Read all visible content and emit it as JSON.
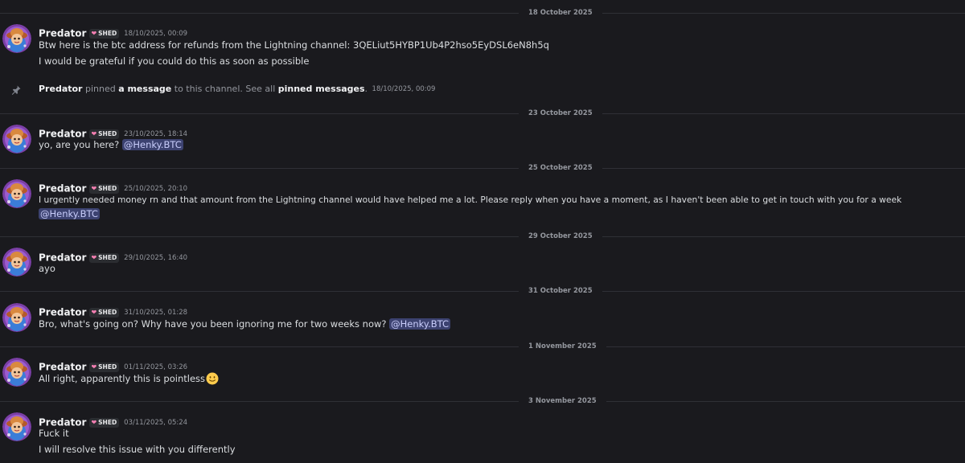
{
  "channel": {
    "author": "Predator",
    "tag": "SHED",
    "mention": "@Henky.BTC"
  },
  "dividers": [
    "18 October 2025",
    "23 October 2025",
    "25 October 2025",
    "29 October 2025",
    "31 October 2025",
    "1 November 2025",
    "3 November 2025"
  ],
  "messages": [
    {
      "timestamp": "18/10/2025, 00:09",
      "lines": [
        "Btw here is the btc address for refunds from the Lightning channel: 3QELiut5HYBP1Ub4P2hso5EyDSL6eN8h5q",
        "I would be grateful if you could do this as soon as possible"
      ]
    },
    {
      "timestamp": "23/10/2025, 18:14",
      "lines": [
        "yo, are you here?"
      ]
    },
    {
      "timestamp": "25/10/2025, 20:10",
      "lines": [
        "I urgently needed money rn and that amount from the Lightning channel would have helped me a lot. Please reply when you have a moment, as I haven't been able to get in touch with you for a week"
      ]
    },
    {
      "timestamp": "29/10/2025, 16:40",
      "lines": [
        "ayo"
      ]
    },
    {
      "timestamp": "31/10/2025, 01:28",
      "lines": [
        "Bro, what's going on? Why have you been ignoring me for two weeks now?"
      ]
    },
    {
      "timestamp": "01/11/2025, 03:26",
      "lines": [
        "All right, apparently this is pointless"
      ],
      "emoji": "slightly-smiling-face-icon"
    },
    {
      "timestamp": "03/11/2025, 05:24",
      "lines": [
        "Fuck it",
        "I will resolve this issue with you differently"
      ]
    }
  ],
  "system": {
    "author": "Predator",
    "pinned_text": "pinned",
    "a_message": "a message",
    "to_channel": "to this channel. See all",
    "pinned_messages": "pinned messages",
    "period": ".",
    "timestamp": "18/10/2025, 00:09"
  },
  "icons": {
    "pin": "pin-icon",
    "avatar": "avatar",
    "heart": "heart-icon",
    "emoji": "slightly-smiling-face-icon"
  },
  "colors": {
    "background": "#1a1a1e",
    "mention_bg": "#3c4270",
    "mention_fg": "#c9cdfb",
    "heart": "#f47fb2"
  }
}
